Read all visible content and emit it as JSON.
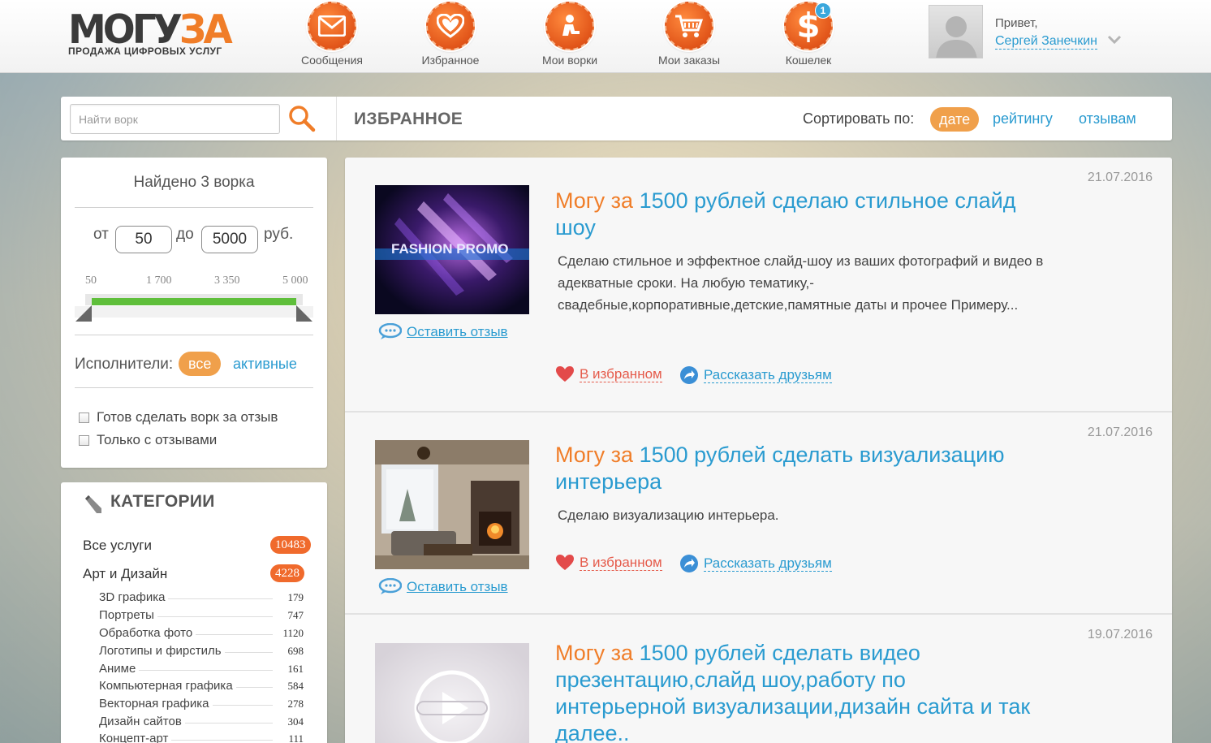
{
  "header": {
    "logo_main": "МОГУ",
    "logo_accent": "ЗА",
    "logo_sub": "ПРОДАЖА ЦИФРОВЫХ УСЛУГ",
    "nav": [
      {
        "label": "Сообщения",
        "icon": "envelope-icon"
      },
      {
        "label": "Избранное",
        "icon": "heart-icon"
      },
      {
        "label": "Мои ворки",
        "icon": "person-desk-icon"
      },
      {
        "label": "Мои заказы",
        "icon": "cart-icon"
      },
      {
        "label": "Кошелек",
        "icon": "dollar-icon",
        "badge": "1"
      }
    ],
    "greeting": "Привет,",
    "user_name": "Сергей Занечкин"
  },
  "search": {
    "placeholder": "Найти ворк",
    "section_title": "ИЗБРАННОЕ",
    "sort_label": "Сортировать по:",
    "sort_options": [
      "дате",
      "рейтингу",
      "отзывам"
    ],
    "sort_selected": "дате"
  },
  "filter": {
    "found_text": "Найдено 3 ворка",
    "from_label": "от",
    "min_value": "50",
    "to_label": "до",
    "max_value": "5000",
    "currency": "руб.",
    "ticks": [
      "50",
      "1 700",
      "3 350",
      "5 000"
    ],
    "performers_label": "Исполнители:",
    "performers_all": "все",
    "performers_active": "активные",
    "checkbox_review": "Готов сделать ворк за отзыв",
    "checkbox_only_reviews": "Только с отзывами"
  },
  "categories": {
    "title": "КАТЕГОРИИ",
    "main": [
      {
        "name": "Все услуги",
        "count": "10483"
      },
      {
        "name": "Арт и Дизайн",
        "count": "4228"
      }
    ],
    "sub": [
      {
        "name": "3D графика",
        "count": "179"
      },
      {
        "name": "Портреты",
        "count": "747"
      },
      {
        "name": "Обработка фото",
        "count": "1120"
      },
      {
        "name": "Логотипы и фирстиль",
        "count": "698"
      },
      {
        "name": "Аниме",
        "count": "161"
      },
      {
        "name": "Компьютерная графика",
        "count": "584"
      },
      {
        "name": "Векторная графика",
        "count": "278"
      },
      {
        "name": "Дизайн сайтов",
        "count": "304"
      },
      {
        "name": "Концепт-арт",
        "count": "111"
      }
    ]
  },
  "cards": [
    {
      "date": "21.07.2016",
      "title_prefix": "Могу за",
      "title_rest": " 1500 рублей сделаю стильное слайд шоу",
      "description": "Сделаю стильное и эффектное слайд-шоу из ваших фотографий и видео в адекватные сроки. На любую тематику,-свадебные,корпоративные,детские,памятные даты и прочее Примеру...",
      "thumb_text": "FASHION PROMO",
      "fav_label": "В избранном",
      "share_label": "Рассказать друзьям",
      "review_label": "Оставить отзыв"
    },
    {
      "date": "21.07.2016",
      "title_prefix": "Могу за",
      "title_rest": " 1500 рублей сделать визуализацию интерьера",
      "description": "Сделаю визуализацию интерьера.",
      "fav_label": "В избранном",
      "share_label": "Рассказать друзьям",
      "review_label": "Оставить отзыв"
    },
    {
      "date": "19.07.2016",
      "title_prefix": "Могу за",
      "title_rest": " 1500 рублей сделать видео презентацию,слайд шоу,работу по интерьерной визуализации,дизайн сайта и так далее.."
    }
  ],
  "colors": {
    "accent_orange": "#f07d28",
    "link_blue": "#2a9bd0",
    "pill_orange": "#f0a04b",
    "slider_green": "#5fbf3b"
  }
}
